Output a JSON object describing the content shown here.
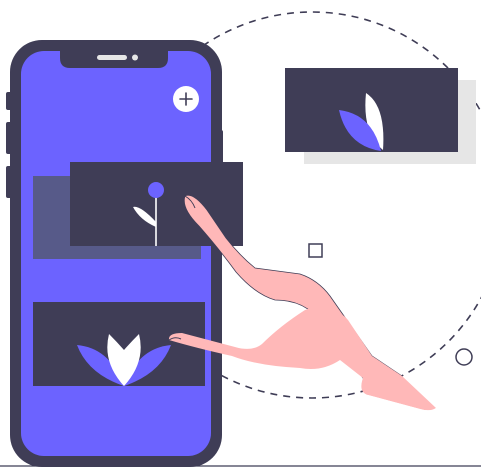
{
  "illustration": {
    "subject": "hand-tapping-phone-gallery",
    "colors": {
      "phone_body": "#3f3d56",
      "screen": "#6c63ff",
      "screen_shadow": "#575a89",
      "card_dark": "#3f3d56",
      "card_shadow": "#e6e6e6",
      "flower_primary": "#6c63ff",
      "flower_light": "#ffffff",
      "hand": "#ffb8b8",
      "outline": "#3f3d56",
      "dashed_orbit": "#3f3d56"
    },
    "icons": {
      "add": "plus-icon",
      "flower_card_top_right": "leaf-icon",
      "flower_card_middle": "sprout-icon",
      "flower_card_bottom": "lotus-icon",
      "hand": "pointing-hand-icon"
    }
  }
}
